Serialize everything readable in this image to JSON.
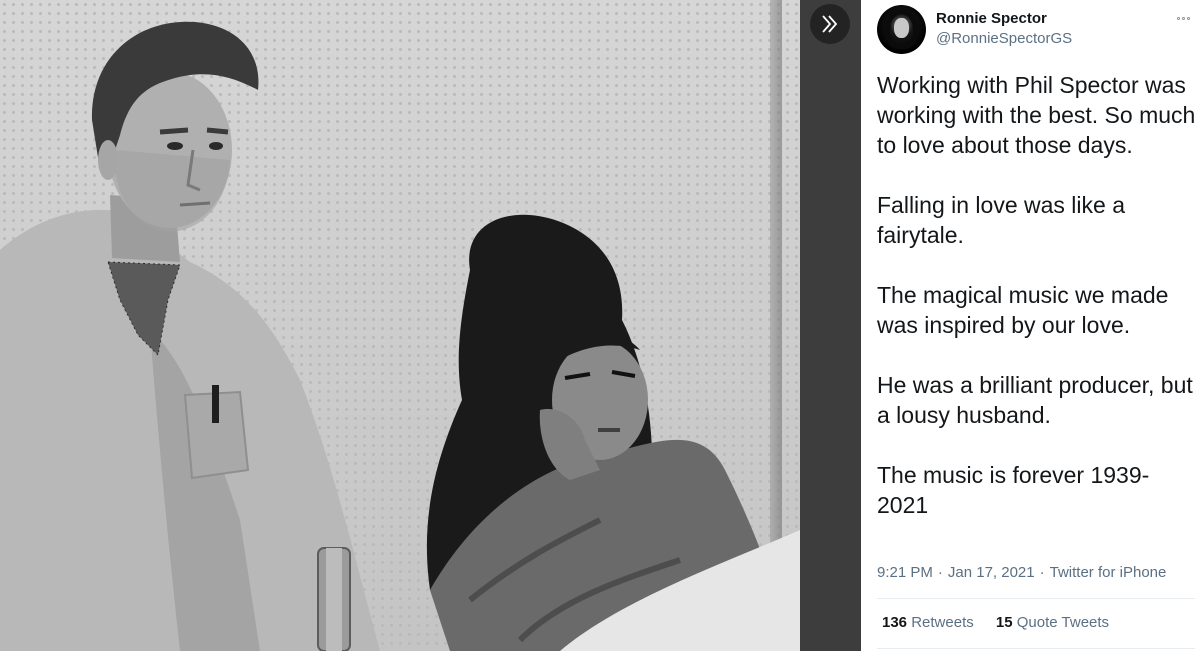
{
  "media": {
    "description_icon": "photo",
    "expand_icon": "double-chevron-right-icon"
  },
  "tweet": {
    "author": {
      "name": "Ronnie Spector",
      "handle": "@RonnieSpectorGS"
    },
    "more_icon": "more-options-icon",
    "paragraphs": [
      "Working with Phil Spector was working with the best. So much to love about those days.",
      "Falling in love was like a fairytale.",
      "The magical music we made was inspired by our love.",
      "He was a brilliant producer, but a lousy husband.",
      "The music is forever 1939-2021"
    ],
    "meta": {
      "time": "9:21 PM",
      "separator": "·",
      "date": "Jan 17, 2021",
      "source": "Twitter for iPhone"
    },
    "stats": {
      "retweets_count": "136",
      "retweets_label": "Retweets",
      "quotes_count": "15",
      "quotes_label": "Quote Tweets"
    }
  },
  "colors": {
    "text_primary": "#14171a",
    "text_secondary": "#5b7083",
    "gutter": "#3d3d3d",
    "divider": "#e6ecf0"
  }
}
